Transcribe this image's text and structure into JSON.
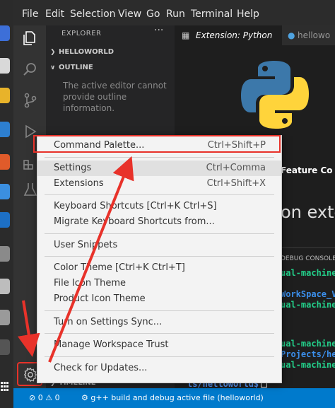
{
  "menubar": {
    "items": [
      "File",
      "Edit",
      "Selection",
      "View",
      "Go",
      "Run",
      "Terminal",
      "Help"
    ]
  },
  "sidebar": {
    "title": "EXPLORER",
    "more": "···",
    "sections": {
      "helloworld": "HELLOWORLD",
      "outline": "OUTLINE",
      "timeline": "TIMELINE"
    },
    "outline_message": "The active editor cannot provide outline information."
  },
  "tabs": {
    "active": "Extension: Python",
    "inactive": "hellowo"
  },
  "editor": {
    "feature_tab": "Feature Co",
    "heading_fragment": "on exter",
    "panel_title": "DEBUG CONSOLE",
    "terminal_lines": [
      {
        "text": "ual-machine",
        "color": "#23d18b"
      },
      {
        "text": "WorkSpace_V",
        "color": "#3b8eea"
      },
      {
        "text": "ual-machine",
        "color": "#23d18b"
      },
      {
        "text": "ual-machine",
        "color": "#23d18b"
      },
      {
        "text": "Projects/he",
        "color": "#3b8eea"
      },
      {
        "text": "ual-machine",
        "color": "#23d18b"
      }
    ],
    "prompt": "ts/helloworld$"
  },
  "context_menu": {
    "command_palette": {
      "label": "Command Palette...",
      "key": "Ctrl+Shift+P"
    },
    "settings": {
      "label": "Settings",
      "key": "Ctrl+Comma"
    },
    "extensions": {
      "label": "Extensions",
      "key": "Ctrl+Shift+X"
    },
    "keyboard_shortcuts": {
      "label": "Keyboard Shortcuts [Ctrl+K Ctrl+S]"
    },
    "migrate_shortcuts": {
      "label": "Migrate Keyboard Shortcuts from..."
    },
    "user_snippets": {
      "label": "User Snippets"
    },
    "color_theme": {
      "label": "Color Theme [Ctrl+K Ctrl+T]"
    },
    "file_icon_theme": {
      "label": "File Icon Theme"
    },
    "product_icon_theme": {
      "label": "Product Icon Theme"
    },
    "settings_sync": {
      "label": "Turn on Settings Sync..."
    },
    "workspace_trust": {
      "label": "Manage Workspace Trust"
    },
    "check_updates": {
      "label": "Check for Updates..."
    }
  },
  "statusbar": {
    "errors": "0",
    "warnings": "0",
    "build": "g++ build and debug active file (helloworld)"
  },
  "colors": {
    "accent": "#007acc",
    "highlight": "#e8322a",
    "menu_background": "#f3f3f3"
  }
}
